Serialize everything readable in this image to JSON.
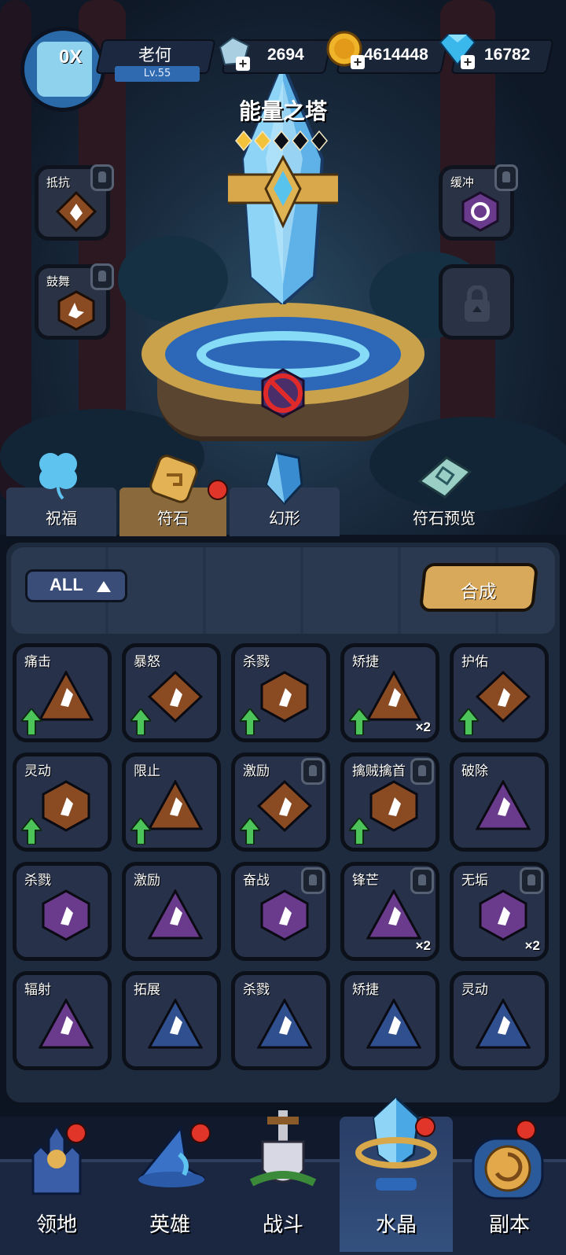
{
  "header": {
    "player_name": "老何",
    "level": "Lv.55",
    "avatar_badge": "0X",
    "resources": [
      {
        "name": "silver-crystal",
        "value": "2694"
      },
      {
        "name": "gold-coin",
        "value": "4614448"
      },
      {
        "name": "diamond",
        "value": "16782"
      }
    ]
  },
  "tower": {
    "title": "能量之塔",
    "stars_filled": 2,
    "stars_total": 5
  },
  "side_slots": {
    "left": [
      {
        "label": "抵抗",
        "locked": true
      },
      {
        "label": "鼓舞",
        "locked": true
      }
    ],
    "right": [
      {
        "label": "缓冲",
        "locked": true
      },
      {
        "label": "",
        "locked": true
      }
    ]
  },
  "tabs": [
    {
      "label": "祝福"
    },
    {
      "label": "符石",
      "active": true,
      "badge": true
    },
    {
      "label": "幻形"
    },
    {
      "label": "符石预览"
    }
  ],
  "inventory": {
    "filter_label": "ALL",
    "merge_label": "合成",
    "cards": [
      {
        "label": "痛击",
        "tier": "bronze",
        "up": true,
        "qty": "",
        "locked": false
      },
      {
        "label": "暴怒",
        "tier": "bronze",
        "up": true,
        "qty": "",
        "locked": false
      },
      {
        "label": "杀戮",
        "tier": "bronze",
        "up": true,
        "qty": "",
        "locked": false
      },
      {
        "label": "矫捷",
        "tier": "bronze",
        "up": true,
        "qty": "×2",
        "locked": false
      },
      {
        "label": "护佑",
        "tier": "bronze",
        "up": true,
        "qty": "",
        "locked": false
      },
      {
        "label": "灵动",
        "tier": "bronze",
        "up": true,
        "qty": "",
        "locked": false
      },
      {
        "label": "限止",
        "tier": "bronze",
        "up": true,
        "qty": "",
        "locked": false
      },
      {
        "label": "激励",
        "tier": "bronze",
        "up": true,
        "qty": "",
        "locked": true
      },
      {
        "label": "擒贼擒首",
        "tier": "bronze",
        "up": true,
        "qty": "",
        "locked": true
      },
      {
        "label": "破除",
        "tier": "purple",
        "up": false,
        "qty": "",
        "locked": false
      },
      {
        "label": "杀戮",
        "tier": "purple",
        "up": false,
        "qty": "",
        "locked": false
      },
      {
        "label": "激励",
        "tier": "purple",
        "up": false,
        "qty": "",
        "locked": false
      },
      {
        "label": "奋战",
        "tier": "purple",
        "up": false,
        "qty": "",
        "locked": true
      },
      {
        "label": "锋芒",
        "tier": "purple",
        "up": false,
        "qty": "×2",
        "locked": true
      },
      {
        "label": "无垢",
        "tier": "purple",
        "up": false,
        "qty": "×2",
        "locked": true
      },
      {
        "label": "辐射",
        "tier": "purple",
        "up": false,
        "qty": "",
        "locked": false
      },
      {
        "label": "拓展",
        "tier": "blue",
        "up": false,
        "qty": "",
        "locked": false
      },
      {
        "label": "杀戮",
        "tier": "blue",
        "up": false,
        "qty": "",
        "locked": false
      },
      {
        "label": "矫捷",
        "tier": "blue",
        "up": false,
        "qty": "",
        "locked": false
      },
      {
        "label": "灵动",
        "tier": "blue",
        "up": false,
        "qty": "",
        "locked": false
      }
    ]
  },
  "nav": [
    {
      "label": "领地",
      "badge": true
    },
    {
      "label": "英雄",
      "badge": true
    },
    {
      "label": "战斗",
      "badge": false
    },
    {
      "label": "水晶",
      "badge": true,
      "active": true
    },
    {
      "label": "副本",
      "badge": true
    }
  ],
  "colors": {
    "bronze": "#8a4a22",
    "purple": "#6a3a8c",
    "blue": "#2f4f8e",
    "up_arrow": "#4cc45a",
    "badge_red": "#e2352a"
  }
}
